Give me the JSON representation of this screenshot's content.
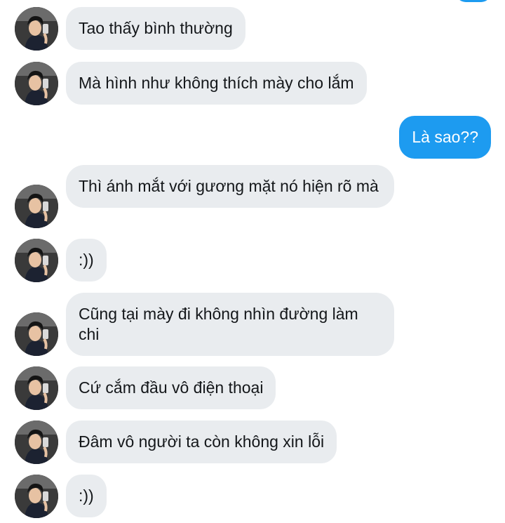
{
  "conversation": {
    "messages": [
      {
        "direction": "in",
        "text": "Tao thấy bình thường"
      },
      {
        "direction": "in",
        "text": "Mà hình như không thích mày cho lắm"
      },
      {
        "direction": "out",
        "text": "Là sao??"
      },
      {
        "direction": "in",
        "text": "Thì ánh mắt với gương mặt nó hiện rõ mà"
      },
      {
        "direction": "in",
        "text": ":))"
      },
      {
        "direction": "in",
        "text": "Cũng tại mày đi không nhìn đường làm chi"
      },
      {
        "direction": "in",
        "text": "Cứ cắm đầu vô điện thoại"
      },
      {
        "direction": "in",
        "text": "Đâm vô người ta còn không xin lỗi"
      },
      {
        "direction": "in",
        "text": ":))"
      }
    ],
    "colors": {
      "incoming_bubble": "#e9ecef",
      "outgoing_bubble": "#1d9bf0",
      "incoming_text": "#14171a",
      "outgoing_text": "#ffffff"
    },
    "avatar_icon": "user-avatar-photo"
  }
}
